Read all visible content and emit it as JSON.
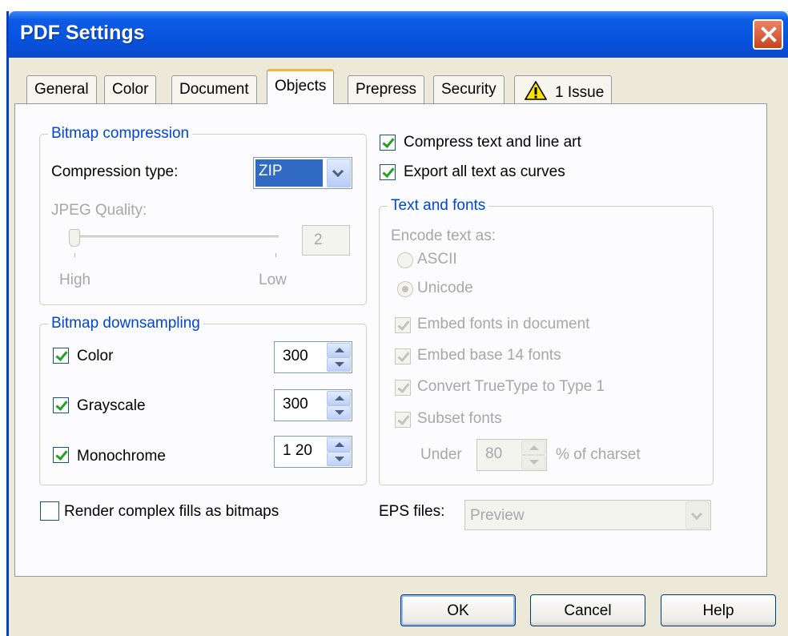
{
  "window": {
    "title": "PDF Settings"
  },
  "tabs": [
    {
      "label": "General"
    },
    {
      "label": "Color"
    },
    {
      "label": "Document"
    },
    {
      "label": "Objects",
      "active": true
    },
    {
      "label": "Prepress"
    },
    {
      "label": "Security"
    },
    {
      "label": "1 Issue",
      "icon": "warning-icon"
    }
  ],
  "bitmap_compression": {
    "legend": "Bitmap compression",
    "compression_type_label": "Compression type:",
    "compression_type_value": "ZIP",
    "jpeg_quality_label": "JPEG Quality:",
    "jpeg_quality_value": "2",
    "slider_high_label": "High",
    "slider_low_label": "Low"
  },
  "bitmap_downsampling": {
    "legend": "Bitmap downsampling",
    "rows": [
      {
        "label": "Color",
        "checked": true,
        "value": "300"
      },
      {
        "label": "Grayscale",
        "checked": true,
        "value": "300"
      },
      {
        "label": "Monochrome",
        "checked": true,
        "value": "1 20"
      }
    ]
  },
  "options": {
    "compress_text_label": "Compress text and line art",
    "compress_text_checked": true,
    "export_curves_label": "Export all text as curves",
    "export_curves_checked": true,
    "render_fills_label": "Render complex fills as bitmaps",
    "render_fills_checked": false
  },
  "text_and_fonts": {
    "legend": "Text and fonts",
    "encode_label": "Encode text as:",
    "ascii_label": "ASCII",
    "unicode_label": "Unicode",
    "selected_encoding": "Unicode",
    "embed_fonts_label": "Embed fonts in document",
    "embed_base14_label": "Embed base 14 fonts",
    "convert_truetype_label": "Convert TrueType to Type 1",
    "subset_fonts_label": "Subset fonts",
    "under_label": "Under",
    "under_value": "80",
    "charset_label": "% of charset"
  },
  "eps": {
    "label": "EPS files:",
    "value": "Preview"
  },
  "buttons": {
    "ok": "OK",
    "cancel": "Cancel",
    "help": "Help"
  },
  "colors": {
    "titlebar": "#0753df",
    "group_legend": "#0046d5",
    "active_tab_accent": "#f7b538",
    "close_button": "#d9542b"
  }
}
